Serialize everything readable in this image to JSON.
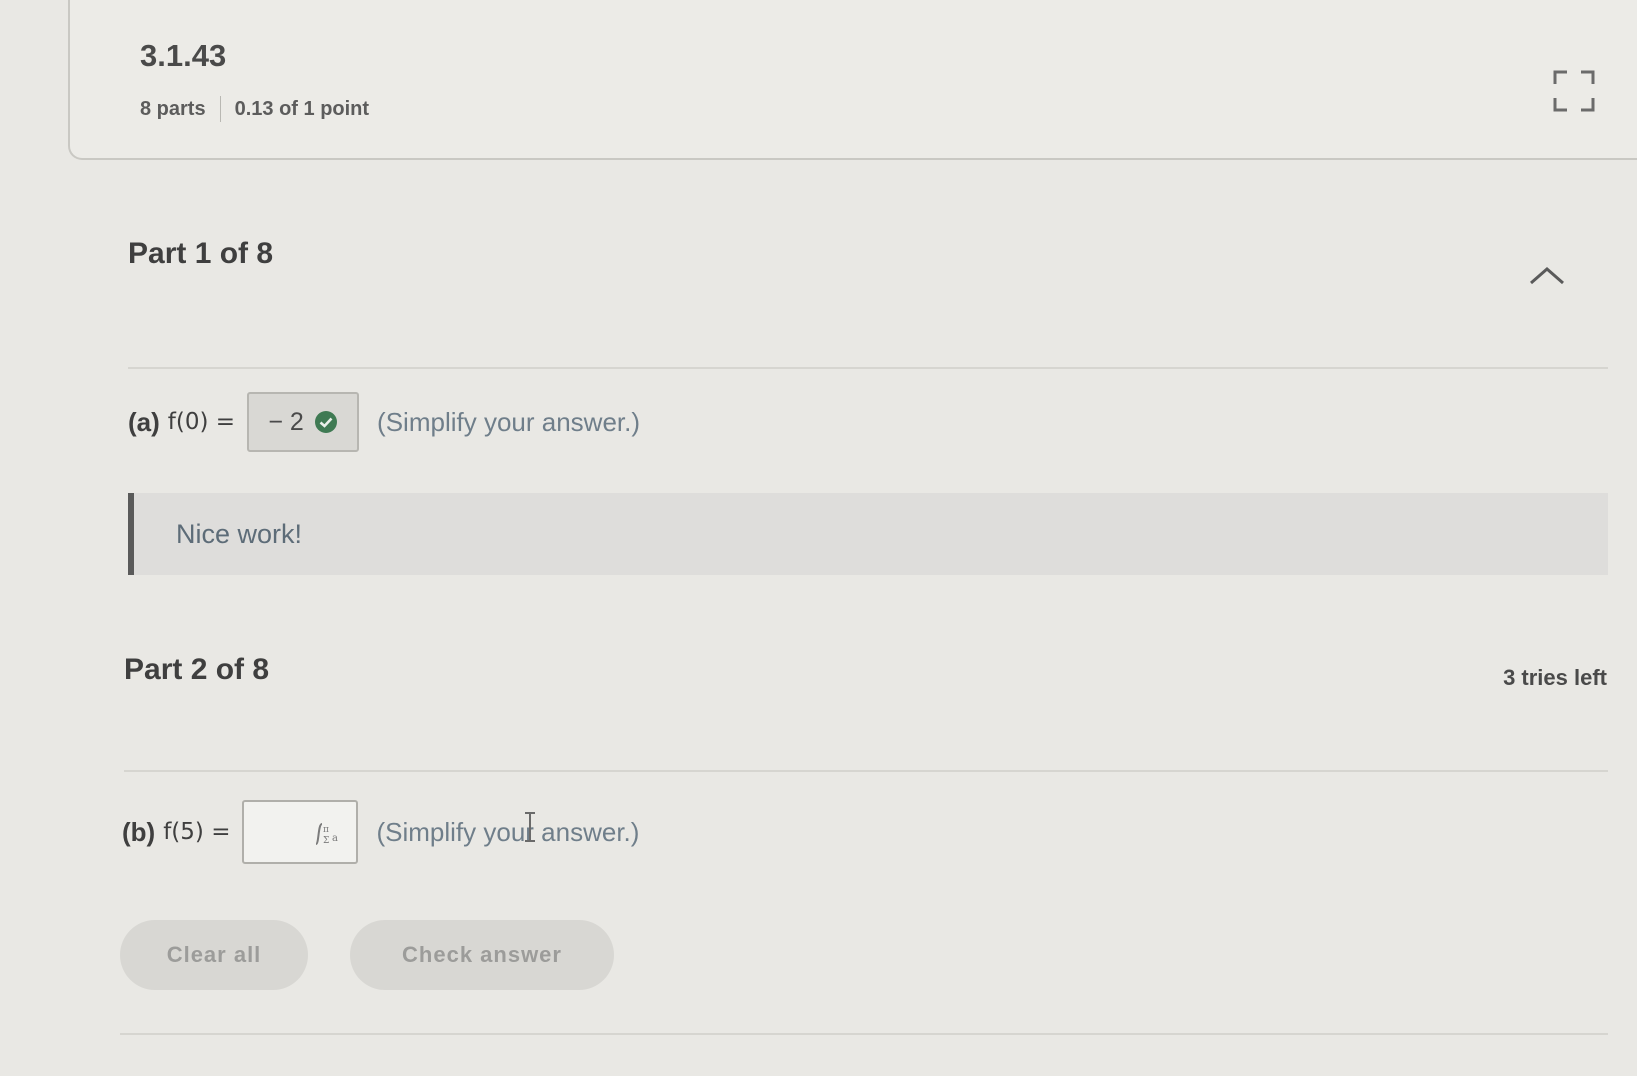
{
  "header": {
    "problem_id": "3.1.43",
    "parts": "8 parts",
    "score": "0.13 of 1 point",
    "expand_icon": "expand-icon"
  },
  "part1": {
    "title": "Part 1 of 8",
    "collapse_icon": "chevron-up-icon",
    "question": {
      "label": "(a)",
      "expression": "f(0) =",
      "answer": "− 2",
      "status_icon": "check-circle-icon",
      "status_color": "#3f7a53",
      "instruction": "(Simplify your answer.)"
    },
    "feedback": "Nice work!"
  },
  "part2": {
    "title": "Part 2 of 8",
    "tries": "3 tries left",
    "question": {
      "label": "(b)",
      "expression": "f(5) =",
      "answer": "",
      "math_icon": "math-template-icon",
      "instruction": "(Simplify your answer.)"
    }
  },
  "buttons": {
    "clear_all": "Clear all",
    "check_answer": "Check answer"
  }
}
